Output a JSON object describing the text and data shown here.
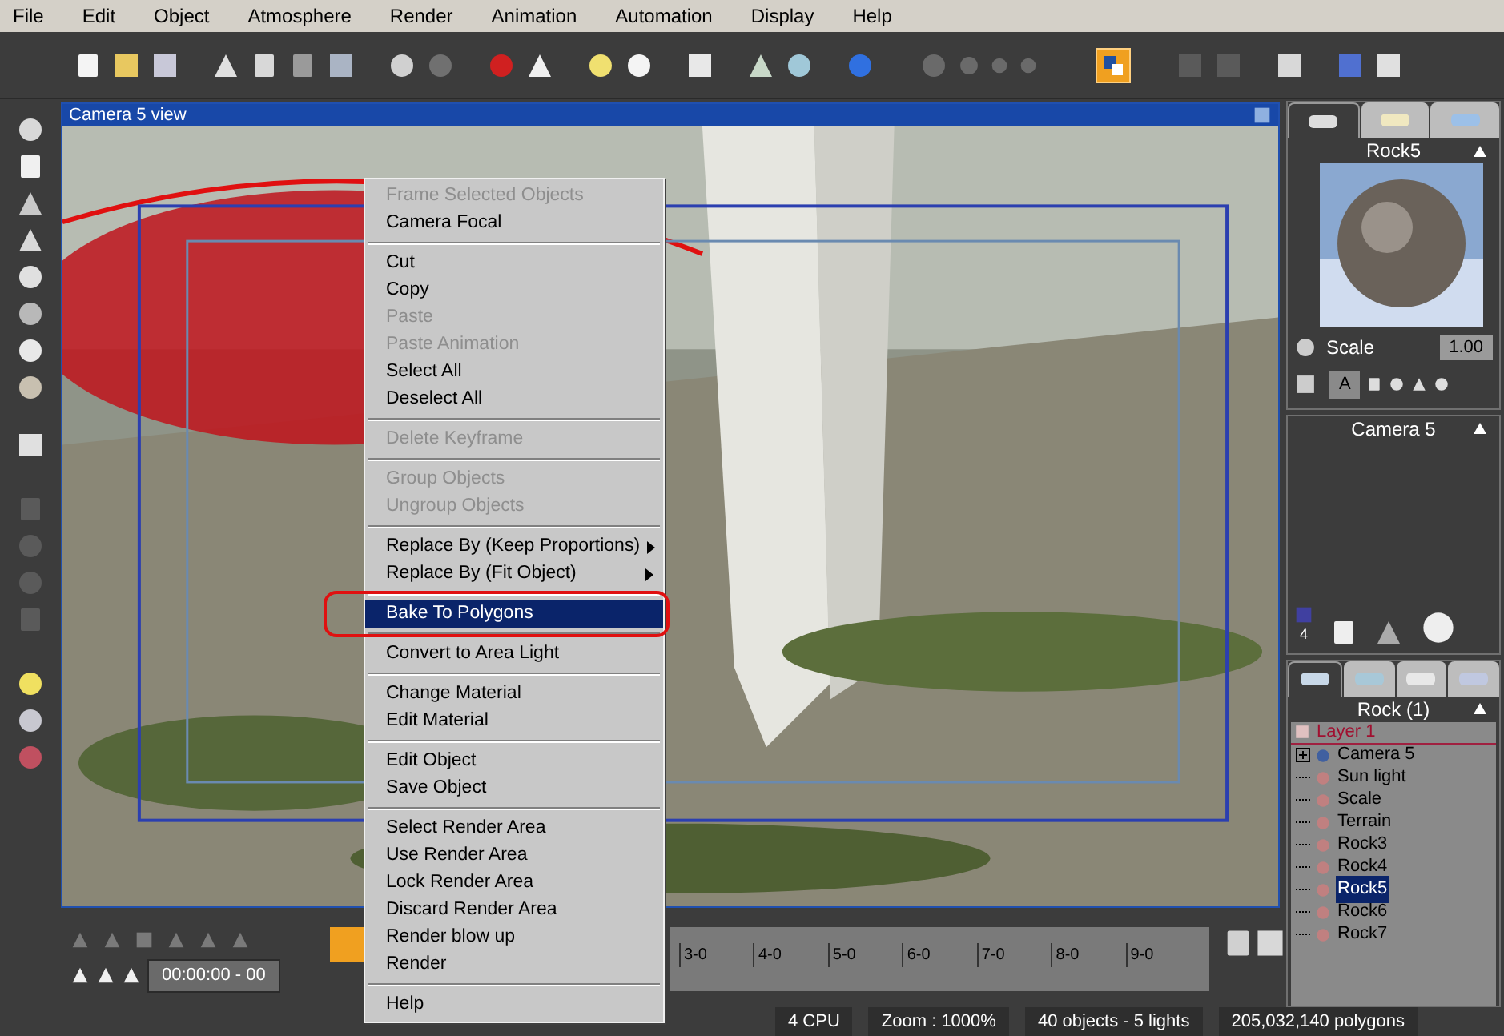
{
  "menu_bar": [
    "File",
    "Edit",
    "Object",
    "Atmosphere",
    "Render",
    "Animation",
    "Automation",
    "Display",
    "Help"
  ],
  "viewport": {
    "title": "Camera 5 view"
  },
  "context_menu": [
    [
      {
        "label": "Frame Selected Objects",
        "disabled": true,
        "selected": false
      },
      {
        "label": "Camera Focal",
        "disabled": false,
        "selected": false
      }
    ],
    [
      {
        "label": "Cut",
        "disabled": false,
        "selected": false
      },
      {
        "label": "Copy",
        "disabled": false,
        "selected": false
      },
      {
        "label": "Paste",
        "disabled": true,
        "selected": false
      },
      {
        "label": "Paste Animation",
        "disabled": true,
        "selected": false
      },
      {
        "label": "Select All",
        "disabled": false,
        "selected": false
      },
      {
        "label": "Deselect All",
        "disabled": false,
        "selected": false
      }
    ],
    [
      {
        "label": "Delete Keyframe",
        "disabled": true,
        "selected": false
      }
    ],
    [
      {
        "label": "Group Objects",
        "disabled": true,
        "selected": false
      },
      {
        "label": "Ungroup Objects",
        "disabled": true,
        "selected": false
      }
    ],
    [
      {
        "label": "Replace By (Keep Proportions)",
        "disabled": false,
        "selected": false,
        "submenu": true
      },
      {
        "label": "Replace By (Fit Object)",
        "disabled": false,
        "selected": false,
        "submenu": true
      }
    ],
    [
      {
        "label": "Bake To Polygons",
        "disabled": false,
        "selected": true,
        "circled": true
      }
    ],
    [
      {
        "label": "Convert to Area Light",
        "disabled": false,
        "selected": false
      }
    ],
    [
      {
        "label": "Change Material",
        "disabled": false,
        "selected": false
      },
      {
        "label": "Edit Material",
        "disabled": false,
        "selected": false
      }
    ],
    [
      {
        "label": "Edit Object",
        "disabled": false,
        "selected": false
      },
      {
        "label": "Save Object",
        "disabled": false,
        "selected": false
      }
    ],
    [
      {
        "label": "Select Render Area",
        "disabled": false,
        "selected": false
      },
      {
        "label": "Use Render Area",
        "disabled": false,
        "selected": false
      },
      {
        "label": "Lock Render Area",
        "disabled": false,
        "selected": false
      },
      {
        "label": "Discard Render Area",
        "disabled": false,
        "selected": false
      },
      {
        "label": "Render blow up",
        "disabled": false,
        "selected": false
      },
      {
        "label": "Render",
        "disabled": false,
        "selected": false
      }
    ],
    [
      {
        "label": "Help",
        "disabled": false,
        "selected": false
      }
    ]
  ],
  "material_panel": {
    "tabs": [
      {
        "selected": true
      },
      {
        "selected": false
      },
      {
        "selected": false
      }
    ],
    "title": "Rock5",
    "scale_label": "Scale",
    "scale_value": "1.00",
    "mode": "A"
  },
  "camera_panel": {
    "title": "Camera 5",
    "slot": "4"
  },
  "object_panel": {
    "tabs": [
      {
        "selected": true
      },
      {
        "selected": false
      },
      {
        "selected": false
      },
      {
        "selected": false
      }
    ],
    "title": "Rock (1)",
    "layer": "Layer 1",
    "tree": [
      {
        "label": "Camera 5",
        "selected": false,
        "expanded": false
      },
      {
        "label": "Sun light",
        "selected": false
      },
      {
        "label": "Scale",
        "selected": false
      },
      {
        "label": "Terrain",
        "selected": false
      },
      {
        "label": "Rock3",
        "selected": false
      },
      {
        "label": "Rock4",
        "selected": false
      },
      {
        "label": "Rock5",
        "selected": true
      },
      {
        "label": "Rock6",
        "selected": false
      },
      {
        "label": "Rock7",
        "selected": false
      }
    ]
  },
  "timeline": {
    "time": "00:00:00 - 00",
    "ticks": [
      "3-0",
      "4-0",
      "5-0",
      "6-0",
      "7-0",
      "8-0",
      "9-0"
    ]
  },
  "status_bar": [
    "4 CPU",
    "Zoom : 1000%",
    "40 objects - 5 lights",
    "205,032,140 polygons"
  ]
}
